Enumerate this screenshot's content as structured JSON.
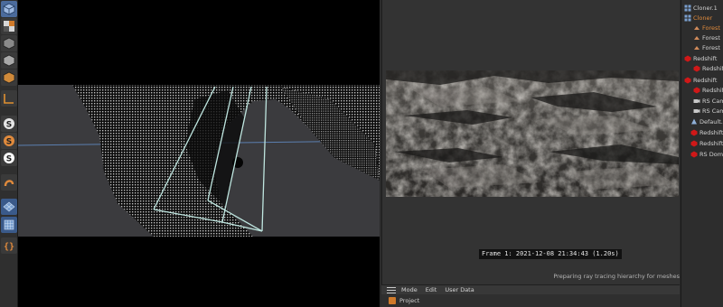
{
  "render_view": {
    "frame_info": "Frame  1:  2021-12-08  21:34:43  (1.20s)",
    "status": "Preparing ray tracing hierarchy for meshes"
  },
  "bottom_manager": {
    "menu": [
      "Mode",
      "Edit",
      "User Data"
    ],
    "project": "Project"
  },
  "object_manager": {
    "items": [
      {
        "label": "Cloner.1",
        "icon": "cloner-icon"
      },
      {
        "label": "Cloner",
        "icon": "cloner-icon"
      },
      {
        "label": "Forest",
        "icon": "mesh-icon"
      },
      {
        "label": "Forest",
        "icon": "mesh-icon"
      },
      {
        "label": "Forest",
        "icon": "mesh-icon"
      },
      {
        "label": "Redshift",
        "icon": "redshift-icon"
      },
      {
        "label": "Redshift",
        "icon": "redshift-icon"
      },
      {
        "label": "Redshift",
        "icon": "redshift-icon"
      },
      {
        "label": "Redshift",
        "icon": "redshift-icon"
      },
      {
        "label": "RS Camera",
        "icon": "camera-icon"
      },
      {
        "label": "RS Camera",
        "icon": "camera-icon"
      },
      {
        "label": "Default.",
        "icon": "light-icon"
      },
      {
        "label": "Redshift",
        "icon": "redshift-icon"
      },
      {
        "label": "Redshift",
        "icon": "redshift-icon"
      },
      {
        "label": "RS Dome",
        "icon": "redshift-icon"
      }
    ]
  },
  "toolbar": {
    "tools": [
      "cube-icon",
      "checker-icon",
      "cube-icon",
      "cube-icon",
      "cube-icon",
      "axis-icon",
      "snap-icon",
      "snap-icon",
      "snap-icon",
      "bend-icon",
      "grid-icon",
      "grid-icon",
      "brackets-icon"
    ]
  },
  "colors": {
    "accent_orange": "#e08a3c",
    "redshift_red": "#d01818",
    "camera_frustum": "#bfe6e0",
    "horizon_blue": "#5b7fb0"
  }
}
